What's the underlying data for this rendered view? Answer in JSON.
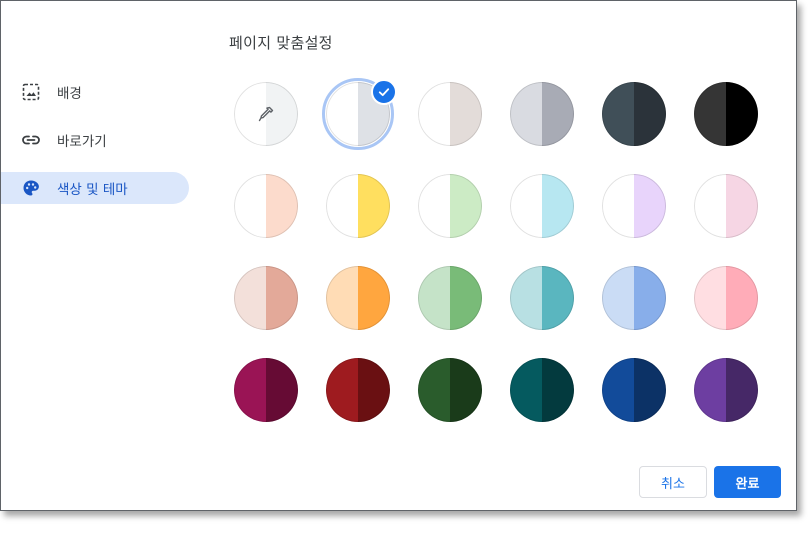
{
  "dialog": {
    "title": "페이지 맞춤설정"
  },
  "sidebar": {
    "items": [
      {
        "label": "배경",
        "icon": "image-icon",
        "active": false
      },
      {
        "label": "바로가기",
        "icon": "link-icon",
        "active": false
      },
      {
        "label": "색상 및 테마",
        "icon": "palette-icon",
        "active": true
      }
    ]
  },
  "themes": {
    "selected_index": 1,
    "swatches": [
      {
        "left": "#ffffff",
        "right": "#f1f3f4",
        "type": "custom-picker"
      },
      {
        "left": "#ffffff",
        "right": "#dee1e6",
        "type": "color"
      },
      {
        "left": "#ffffff",
        "right": "#e3dcd9",
        "type": "color"
      },
      {
        "left": "#d9dbe1",
        "right": "#a8abb5",
        "type": "color"
      },
      {
        "left": "#404f58",
        "right": "#2b333a",
        "type": "color"
      },
      {
        "left": "#353535",
        "right": "#000000",
        "type": "color"
      },
      {
        "left": "#ffffff",
        "right": "#fcdbcc",
        "type": "color"
      },
      {
        "left": "#ffffff",
        "right": "#ffdf5f",
        "type": "color"
      },
      {
        "left": "#ffffff",
        "right": "#ccebc5",
        "type": "color"
      },
      {
        "left": "#ffffff",
        "right": "#b7e7f1",
        "type": "color"
      },
      {
        "left": "#ffffff",
        "right": "#e8d4fb",
        "type": "color"
      },
      {
        "left": "#ffffff",
        "right": "#f6d6e4",
        "type": "color"
      },
      {
        "left": "#f3e0da",
        "right": "#e3a999",
        "type": "color"
      },
      {
        "left": "#ffdcb5",
        "right": "#ffa63f",
        "type": "color"
      },
      {
        "left": "#c5e3c8",
        "right": "#79bb78",
        "type": "color"
      },
      {
        "left": "#b8e0e3",
        "right": "#5ab6bf",
        "type": "color"
      },
      {
        "left": "#cadcf5",
        "right": "#88aeea",
        "type": "color"
      },
      {
        "left": "#ffdee2",
        "right": "#ffacb8",
        "type": "color"
      },
      {
        "left": "#9a1455",
        "right": "#660b34",
        "type": "color"
      },
      {
        "left": "#9e1b1f",
        "right": "#6a1012",
        "type": "color"
      },
      {
        "left": "#2a5c2c",
        "right": "#1a3b1a",
        "type": "color"
      },
      {
        "left": "#055a5f",
        "right": "#033a3e",
        "type": "color"
      },
      {
        "left": "#124b9a",
        "right": "#0c3266",
        "type": "color"
      },
      {
        "left": "#6d3ea1",
        "right": "#462867",
        "type": "color"
      }
    ]
  },
  "footer": {
    "cancel_label": "취소",
    "done_label": "완료"
  }
}
